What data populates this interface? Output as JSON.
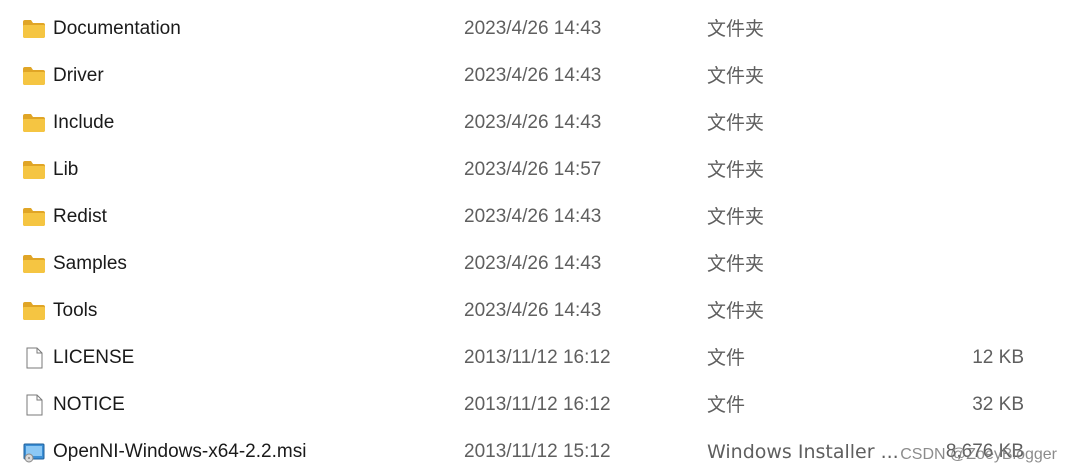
{
  "files": [
    {
      "name": "Documentation",
      "modified": "2023/4/26 14:43",
      "type": "文件夹",
      "size": "",
      "icon": "folder-icon"
    },
    {
      "name": "Driver",
      "modified": "2023/4/26 14:43",
      "type": "文件夹",
      "size": "",
      "icon": "folder-icon"
    },
    {
      "name": "Include",
      "modified": "2023/4/26 14:43",
      "type": "文件夹",
      "size": "",
      "icon": "folder-icon"
    },
    {
      "name": "Lib",
      "modified": "2023/4/26 14:57",
      "type": "文件夹",
      "size": "",
      "icon": "folder-icon"
    },
    {
      "name": "Redist",
      "modified": "2023/4/26 14:43",
      "type": "文件夹",
      "size": "",
      "icon": "folder-icon"
    },
    {
      "name": "Samples",
      "modified": "2023/4/26 14:43",
      "type": "文件夹",
      "size": "",
      "icon": "folder-icon"
    },
    {
      "name": "Tools",
      "modified": "2023/4/26 14:43",
      "type": "文件夹",
      "size": "",
      "icon": "folder-icon"
    },
    {
      "name": "LICENSE",
      "modified": "2013/11/12 16:12",
      "type": "文件",
      "size": "12 KB",
      "icon": "file-icon"
    },
    {
      "name": "NOTICE",
      "modified": "2013/11/12 16:12",
      "type": "文件",
      "size": "32 KB",
      "icon": "file-icon"
    },
    {
      "name": "OpenNI-Windows-x64-2.2.msi",
      "modified": "2013/11/12 15:12",
      "type": "Windows Installer ...",
      "size": "8,676 KB",
      "icon": "msi-installer-icon"
    }
  ],
  "watermark": "CSDN @ZoeyBlogger",
  "colors": {
    "folder": "#f5c542",
    "folder_dark": "#e0a526",
    "text_primary": "#1a1a1a",
    "text_secondary": "#5f5f5f"
  }
}
